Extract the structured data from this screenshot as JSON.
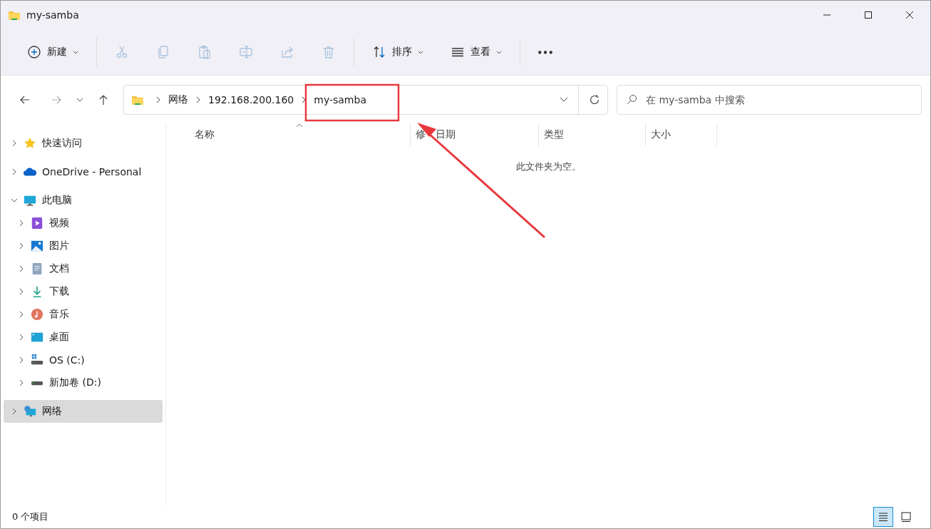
{
  "window": {
    "title": "my-samba"
  },
  "toolbar": [
    {
      "kind": "new",
      "label": "新建",
      "disabled": false,
      "dropdown": true
    },
    {
      "kind": "cut",
      "disabled": true
    },
    {
      "kind": "copy",
      "disabled": true
    },
    {
      "kind": "paste",
      "disabled": true
    },
    {
      "kind": "rename",
      "disabled": true
    },
    {
      "kind": "share",
      "disabled": true
    },
    {
      "kind": "delete",
      "disabled": true
    },
    {
      "kind": "sort",
      "label": "排序",
      "disabled": false,
      "dropdown": true
    },
    {
      "kind": "view",
      "label": "查看",
      "disabled": false,
      "dropdown": true
    },
    {
      "kind": "more",
      "disabled": false
    }
  ],
  "navigation": {
    "back_disabled": false,
    "forward_disabled": true
  },
  "address": {
    "segments": [
      "网络",
      "192.168.200.160",
      "my-samba"
    ]
  },
  "search": {
    "placeholder": "在 my-samba 中搜索"
  },
  "sidebar": {
    "items": [
      {
        "kind": "star",
        "label": "快速访问",
        "expanded": false,
        "selected": false
      },
      {
        "kind": "cloud",
        "label": "OneDrive - Personal",
        "expanded": false,
        "selected": false
      },
      {
        "kind": "pc",
        "label": "此电脑",
        "expanded": true,
        "selected": false,
        "children": [
          {
            "kind": "video",
            "label": "视频",
            "expanded": false,
            "selected": false
          },
          {
            "kind": "pictures",
            "label": "图片",
            "expanded": false,
            "selected": false
          },
          {
            "kind": "documents",
            "label": "文档",
            "expanded": false,
            "selected": false
          },
          {
            "kind": "downloads",
            "label": "下载",
            "expanded": false,
            "selected": false
          },
          {
            "kind": "music",
            "label": "音乐",
            "expanded": false,
            "selected": false
          },
          {
            "kind": "desktop",
            "label": "桌面",
            "expanded": false,
            "selected": false
          },
          {
            "kind": "osdrive",
            "label": "OS (C:)",
            "expanded": false,
            "selected": false
          },
          {
            "kind": "drive",
            "label": "新加卷 (D:)",
            "expanded": false,
            "selected": false
          }
        ]
      },
      {
        "kind": "network",
        "label": "网络",
        "expanded": false,
        "selected": true
      }
    ]
  },
  "table": {
    "columns": [
      {
        "label": "名称",
        "sorted": true
      },
      {
        "label": "修　日期",
        "sorted": false
      },
      {
        "label": "类型",
        "sorted": false
      },
      {
        "label": "大小",
        "sorted": false
      }
    ],
    "empty_message": "此文件夹为空。"
  },
  "status_bar": {
    "count": "0 个项目",
    "view_buttons": [
      {
        "kind": "details",
        "selected": true
      },
      {
        "kind": "tiles",
        "selected": false
      }
    ]
  },
  "annotation_box": {
    "color": "#e8383d"
  },
  "annotation_arrow": {
    "color": "#e8383d"
  }
}
